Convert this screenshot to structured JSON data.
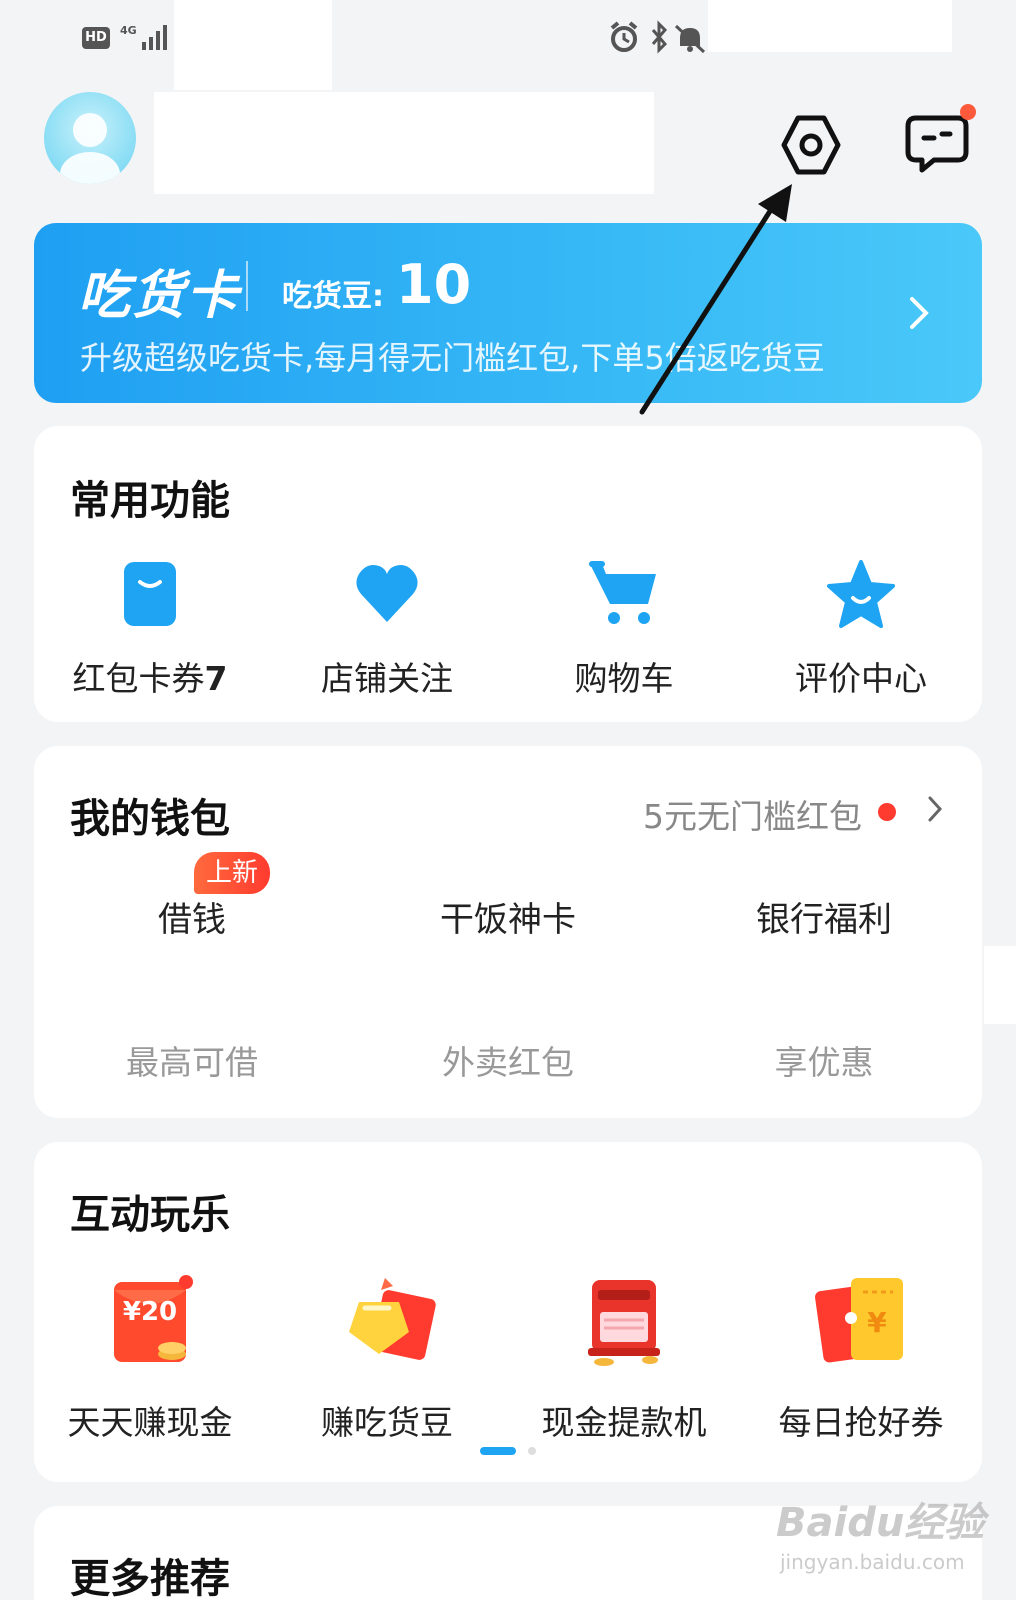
{
  "status_bar": {
    "hd": "HD",
    "network": "4G"
  },
  "header": {
    "settings_icon": "settings-hex-icon",
    "message_icon": "message-bubble-icon"
  },
  "foodie_card": {
    "title": "吃货卡",
    "bean_label": "吃货豆:",
    "bean_value": "10",
    "description": "升级超级吃货卡,每月得无门槛红包,下单5倍返吃货豆"
  },
  "common_functions": {
    "title": "常用功能",
    "items": [
      {
        "label": "红包卡券",
        "count": "7",
        "icon": "coupon-icon"
      },
      {
        "label": "店铺关注",
        "icon": "heart-icon"
      },
      {
        "label": "购物车",
        "icon": "cart-icon"
      },
      {
        "label": "评价中心",
        "icon": "star-icon"
      }
    ]
  },
  "wallet": {
    "title": "我的钱包",
    "promo": "5元无门槛红包",
    "items": [
      {
        "name": "借钱",
        "sub": "最高可借",
        "badge": "上新"
      },
      {
        "name": "干饭神卡",
        "sub": "外卖红包"
      },
      {
        "name": "银行福利",
        "sub": "享优惠"
      }
    ]
  },
  "interactive": {
    "title": "互动玩乐",
    "items": [
      {
        "label": "天天赚现金",
        "icon": "red-envelope-cash-icon",
        "amount": "¥20"
      },
      {
        "label": "赚吃货豆",
        "icon": "bean-gift-icon"
      },
      {
        "label": "现金提款机",
        "icon": "atm-icon"
      },
      {
        "label": "每日抢好券",
        "icon": "coupon-ticket-icon",
        "amount": "¥"
      }
    ]
  },
  "more": {
    "title": "更多推荐"
  },
  "watermark": {
    "text": "Baidu经验",
    "sub": "jingyan.baidu.com"
  },
  "colors": {
    "accent": "#1ea4f2",
    "badge_red": "#ff3b2f",
    "background": "#f3f4f6"
  }
}
